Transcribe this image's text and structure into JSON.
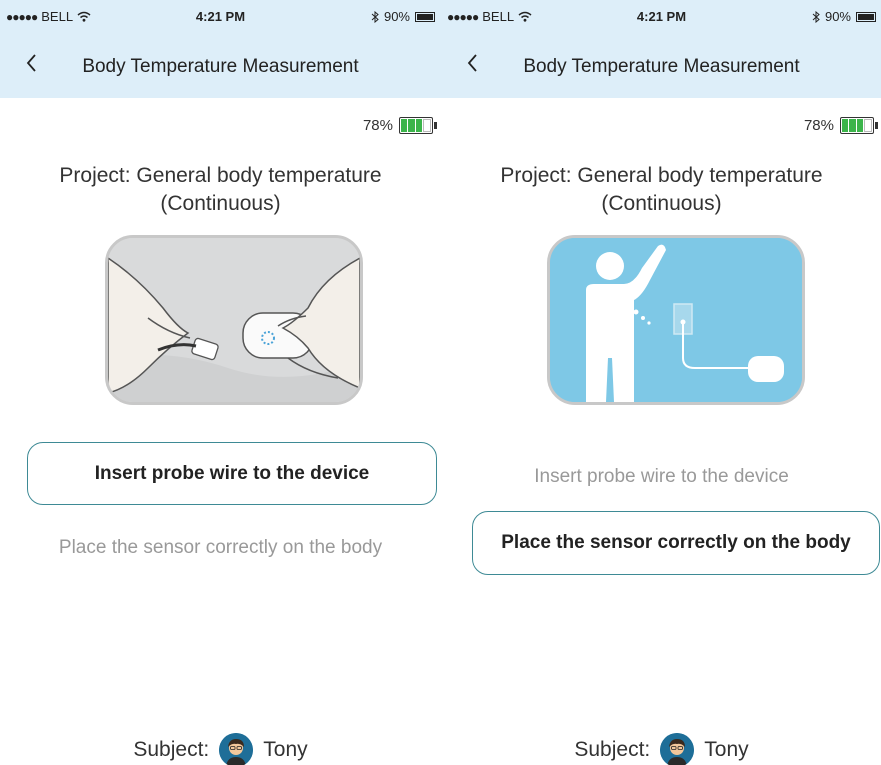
{
  "screens": [
    {
      "status": {
        "carrier": "BELL",
        "time": "4:21 PM",
        "battery": "90%"
      },
      "nav": {
        "title": "Body Temperature Measurement"
      },
      "device_battery": "78%",
      "project_line1": "Project: General body temperature",
      "project_line2": "(Continuous)",
      "illustration_icon": "hands-connecting-probe-image",
      "steps": [
        {
          "label": "Insert probe wire to the device",
          "active": true
        },
        {
          "label": "Place the sensor correctly on the body",
          "active": false
        }
      ],
      "subject": {
        "label": "Subject:",
        "name": "Tony"
      }
    },
    {
      "status": {
        "carrier": "BELL",
        "time": "4:21 PM",
        "battery": "90%"
      },
      "nav": {
        "title": "Body Temperature Measurement"
      },
      "device_battery": "78%",
      "project_line1": "Project: General body temperature",
      "project_line2": "(Continuous)",
      "illustration_icon": "person-sensor-placement-image",
      "steps": [
        {
          "label": "Insert probe wire to the device",
          "active": false
        },
        {
          "label": "Place the sensor correctly on the body",
          "active": true
        }
      ],
      "subject": {
        "label": "Subject:",
        "name": "Tony"
      }
    }
  ],
  "colors": {
    "nav_bg": "#ddeef9",
    "step_border": "#3e8a95",
    "battery_green": "#3bb44a",
    "illustration_blue": "#7ec8e6"
  }
}
